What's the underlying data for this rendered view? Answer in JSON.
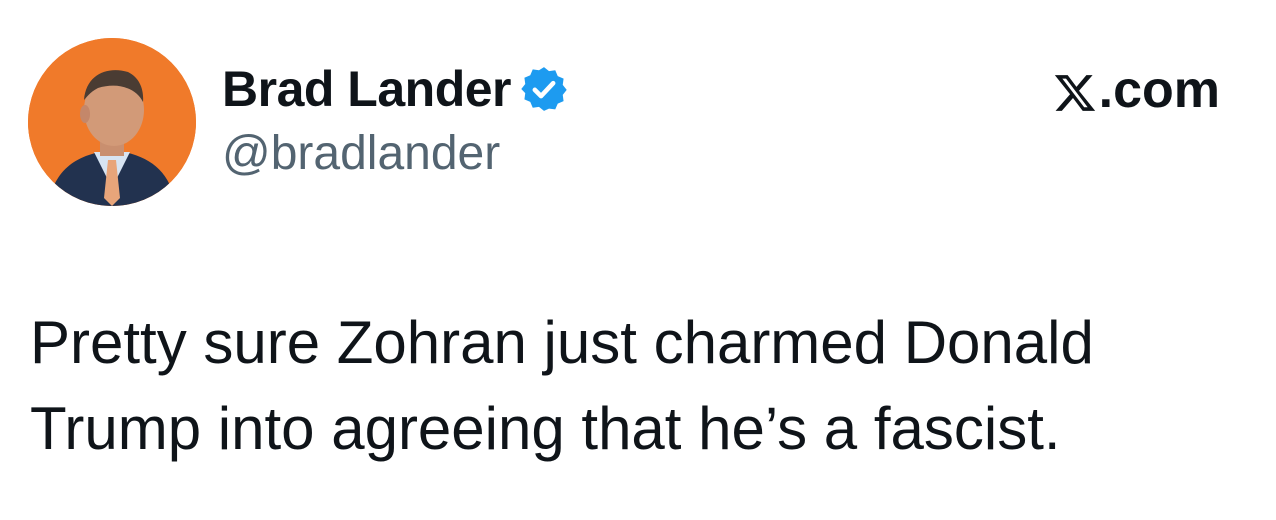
{
  "tweet": {
    "author": {
      "display_name": "Brad Lander",
      "handle": "@bradlander",
      "verified": true,
      "avatar_icon": "profile-photo",
      "avatar_bg": "#f07a2a"
    },
    "site": {
      "logo_icon": "x-logo-icon",
      "label": ".com"
    },
    "text_line1": "Pretty sure Zohran just charmed Donald",
    "text_line2": "Trump into agreeing that he’s a fascist."
  },
  "colors": {
    "verified_badge": "#1d9bf0",
    "handle": "#536471",
    "text": "#0f1419"
  }
}
